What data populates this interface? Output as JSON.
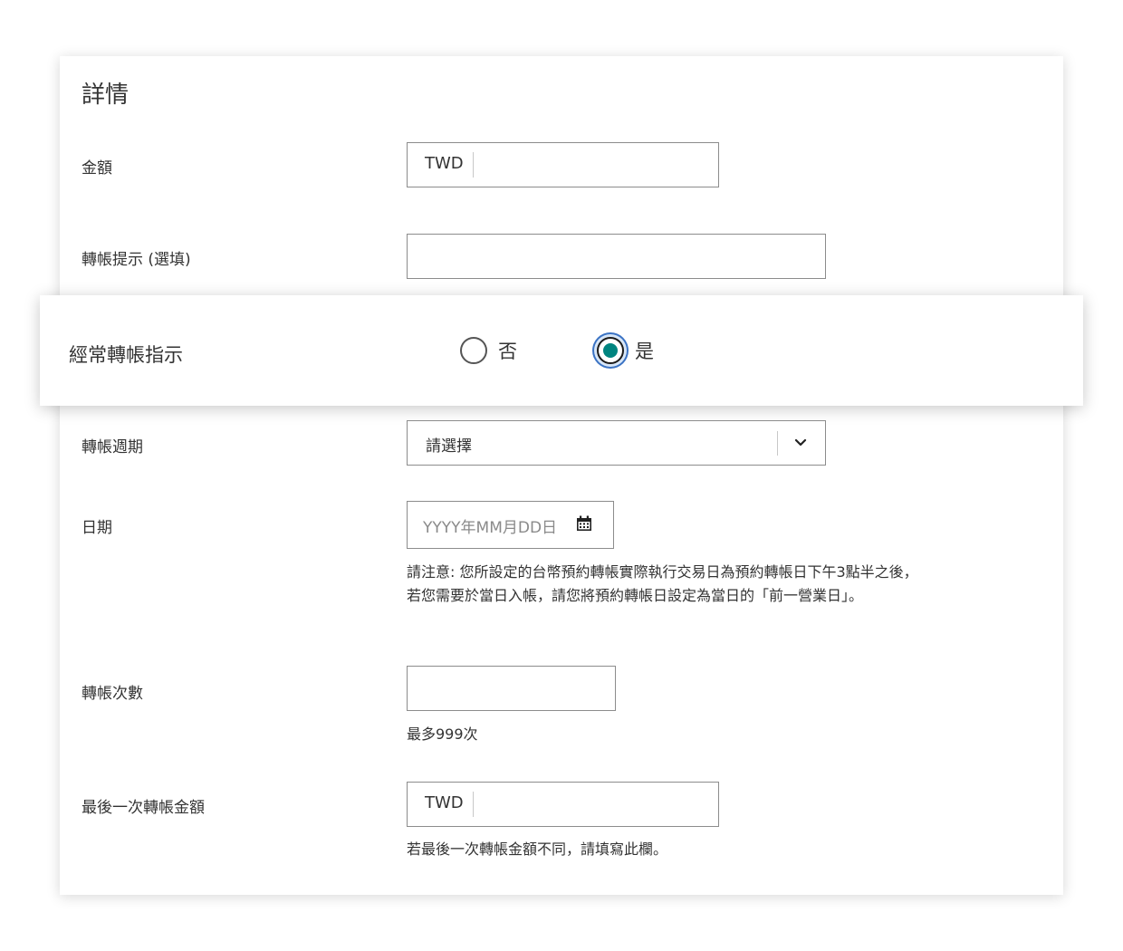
{
  "details": {
    "title": "詳情",
    "amount": {
      "label": "金額",
      "currency": "TWD",
      "value": ""
    },
    "transfer_hint": {
      "label": "轉帳提示 (選填)",
      "value": ""
    },
    "recurring": {
      "label": "經常轉帳指示",
      "options": [
        {
          "label": "否",
          "selected": false
        },
        {
          "label": "是",
          "selected": true
        }
      ]
    },
    "frequency": {
      "label": "轉帳週期",
      "selected": "請選擇"
    },
    "date": {
      "label": "日期",
      "placeholder": "YYYY年MM月DD日",
      "note": "請注意: 您所設定的台幣預約轉帳實際執行交易日為預約轉帳日下午3點半之後，若您需要於當日入帳，請您將預約轉帳日設定為當日的「前一營業日」。"
    },
    "count": {
      "label": "轉帳次數",
      "value": "",
      "note": "最多999次"
    },
    "last_amount": {
      "label": "最後一次轉帳金額",
      "currency": "TWD",
      "value": "",
      "note": "若最後一次轉帳金額不同，請填寫此欄。"
    }
  },
  "colors": {
    "accent": "#00847f",
    "focus_ring": "#3b73c4",
    "border": "#8c8c8c"
  }
}
